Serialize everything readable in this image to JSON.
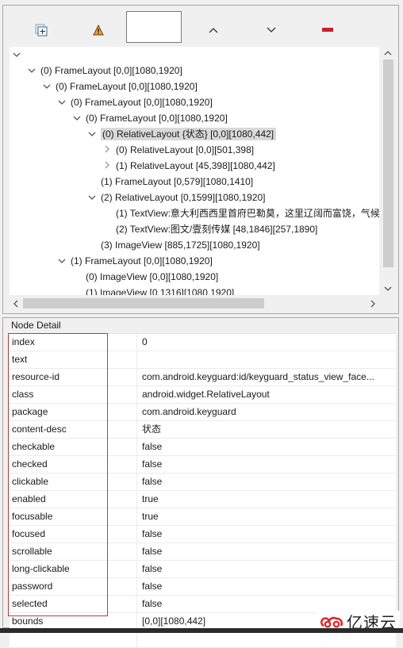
{
  "toolbar": {
    "buttons": [
      {
        "icon": "expand-all-icon"
      },
      {
        "icon": "warning-icon"
      },
      {
        "icon": "previous-icon",
        "glyph": "^"
      },
      {
        "icon": "next-icon",
        "glyph": "v"
      },
      {
        "icon": "clear-icon"
      }
    ],
    "search_value": ""
  },
  "tree": {
    "root_toggle": "⌄",
    "nodes": [
      {
        "depth": 1,
        "toggle": "expanded",
        "label": "(0) FrameLayout [0,0][1080,1920]"
      },
      {
        "depth": 2,
        "toggle": "expanded",
        "label": "(0) FrameLayout [0,0][1080,1920]"
      },
      {
        "depth": 3,
        "toggle": "expanded",
        "label": "(0) FrameLayout [0,0][1080,1920]"
      },
      {
        "depth": 4,
        "toggle": "expanded",
        "label": "(0) FrameLayout [0,0][1080,1920]"
      },
      {
        "depth": 5,
        "toggle": "expanded",
        "label": "(0) RelativeLayout {状态} [0,0][1080,442]",
        "selected": true
      },
      {
        "depth": 6,
        "toggle": "collapsed",
        "label": "(0) RelativeLayout [0,0][501,398]"
      },
      {
        "depth": 6,
        "toggle": "collapsed",
        "label": "(1) RelativeLayout [45,398][1080,442]"
      },
      {
        "depth": 5,
        "toggle": "none",
        "label": "(1) FrameLayout [0,579][1080,1410]"
      },
      {
        "depth": 5,
        "toggle": "expanded",
        "label": "(2) RelativeLayout [0,1599][1080,1920]"
      },
      {
        "depth": 6,
        "toggle": "none",
        "label": "(1) TextView:意大利西西里首府巴勒莫，这里辽阔而富饶，气候"
      },
      {
        "depth": 6,
        "toggle": "none",
        "label": "(2) TextView:图文/壹刻传媒 [48,1846][257,1890]"
      },
      {
        "depth": 5,
        "toggle": "none",
        "label": "(3) ImageView [885,1725][1080,1920]"
      },
      {
        "depth": 3,
        "toggle": "expanded",
        "label": "(1) FrameLayout [0,0][1080,1920]"
      },
      {
        "depth": 4,
        "toggle": "none",
        "label": "(0) ImageView [0,0][1080,1920]"
      },
      {
        "depth": 4,
        "toggle": "none",
        "label": "(1) ImageView [0,1316][1080,1920]"
      }
    ]
  },
  "detail": {
    "title": "Node Detail",
    "rows": [
      {
        "key": "index",
        "value": "0"
      },
      {
        "key": "text",
        "value": ""
      },
      {
        "key": "resource-id",
        "value": "com.android.keyguard:id/keyguard_status_view_face..."
      },
      {
        "key": "class",
        "value": "android.widget.RelativeLayout"
      },
      {
        "key": "package",
        "value": "com.android.keyguard"
      },
      {
        "key": "content-desc",
        "value": "状态"
      },
      {
        "key": "checkable",
        "value": "false"
      },
      {
        "key": "checked",
        "value": "false"
      },
      {
        "key": "clickable",
        "value": "false"
      },
      {
        "key": "enabled",
        "value": "true"
      },
      {
        "key": "focusable",
        "value": "true"
      },
      {
        "key": "focused",
        "value": "false"
      },
      {
        "key": "scrollable",
        "value": "false"
      },
      {
        "key": "long-clickable",
        "value": "false"
      },
      {
        "key": "password",
        "value": "false"
      },
      {
        "key": "selected",
        "value": "false"
      },
      {
        "key": "bounds",
        "value": "[0,0][1080,442]"
      },
      {
        "key": "",
        "value": ""
      }
    ]
  },
  "watermark": {
    "text": "亿速云",
    "color": "#e0282d"
  },
  "colors": {
    "highlight_box": "#b04040",
    "selection": "#d9d9d9",
    "clear_red": "#c8202a",
    "warning": "#e8a040"
  }
}
